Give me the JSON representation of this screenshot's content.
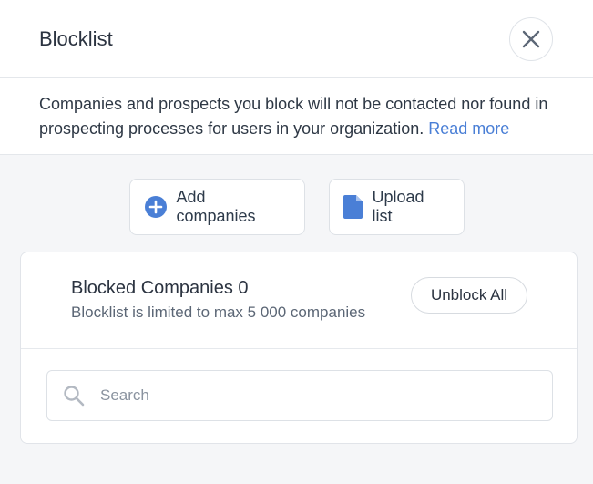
{
  "header": {
    "title": "Blocklist",
    "close_icon": "close-icon"
  },
  "description": {
    "text": "Companies and prospects you block will not be contacted nor found in prospecting processes for users in your organization.",
    "link_label": "Read more"
  },
  "actions": {
    "add": {
      "label": "Add companies",
      "icon": "plus-circle-icon"
    },
    "upload": {
      "label": "Upload list",
      "icon": "document-icon"
    }
  },
  "blocked": {
    "title": "Blocked Companies 0",
    "subtitle": "Blocklist is limited to max 5 000 companies",
    "unblock_label": "Unblock All"
  },
  "search": {
    "placeholder": "Search",
    "value": ""
  },
  "colors": {
    "accent": "#4a7fd6",
    "link": "#4a7fd6",
    "panel_bg": "#f5f6f8"
  }
}
